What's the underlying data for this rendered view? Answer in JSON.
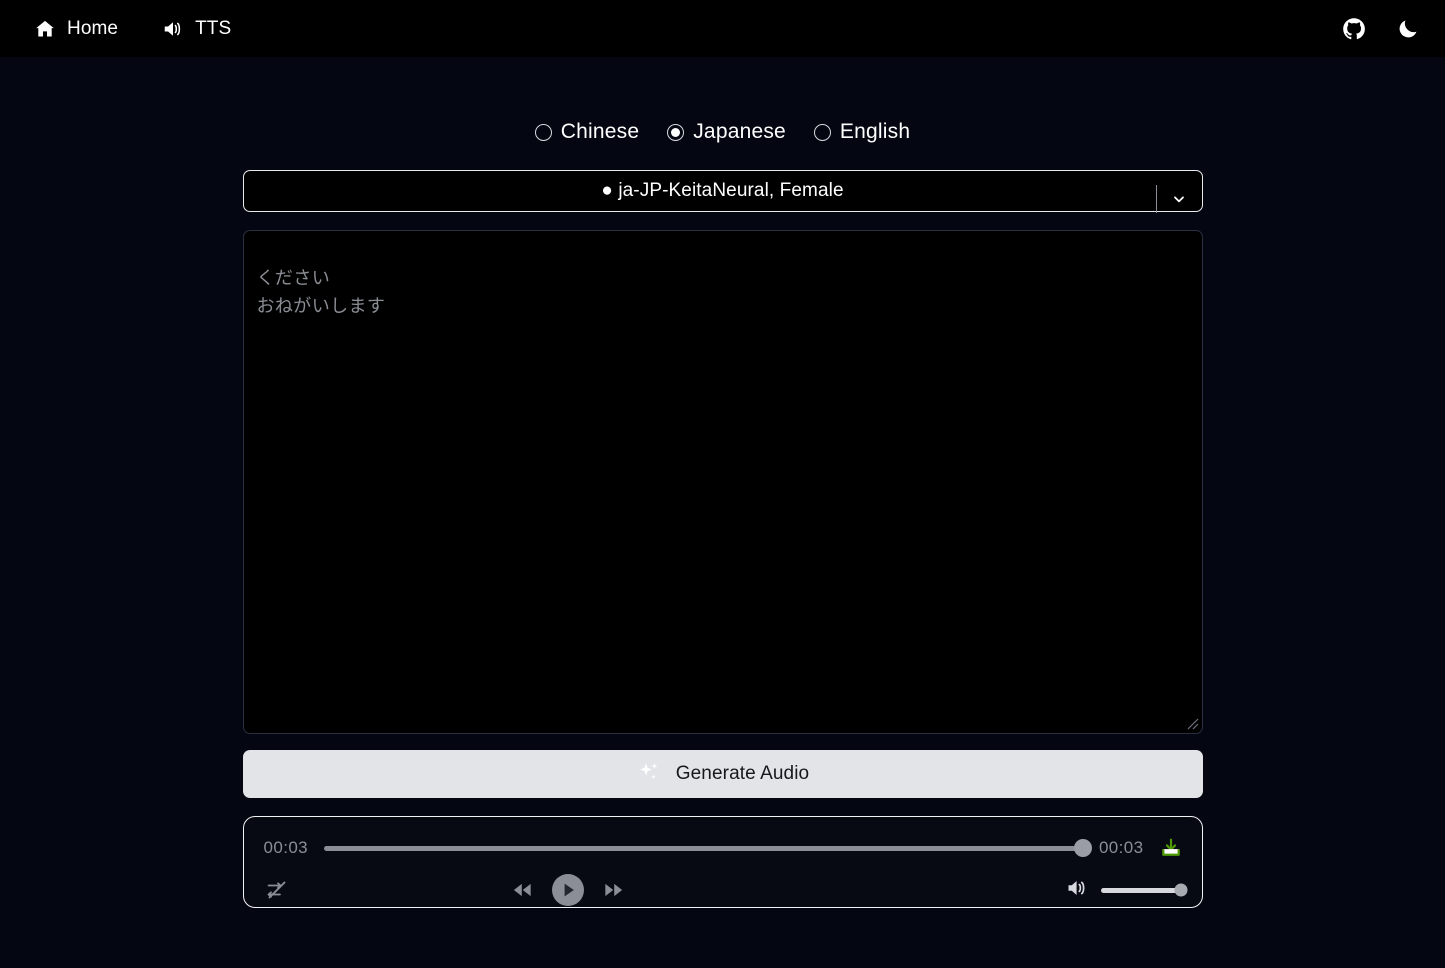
{
  "header": {
    "nav_items": [
      {
        "label": "Home",
        "icon": "home-icon"
      },
      {
        "label": "TTS",
        "icon": "speaker-icon"
      }
    ],
    "github_icon": "github-icon",
    "theme_toggle_icon": "moon-icon"
  },
  "language": {
    "options": [
      {
        "label": "Chinese",
        "selected": false
      },
      {
        "label": "Japanese",
        "selected": true
      },
      {
        "label": "English",
        "selected": false
      }
    ]
  },
  "voice_select": {
    "value": "● ja-JP-KeitaNeural, Female",
    "arrow_icon": "chevron-down-icon"
  },
  "input": {
    "text": "ください\nおねがいします",
    "placeholder": "ください\nおねがいします"
  },
  "generate": {
    "label": "Generate Audio",
    "icon": "sparkles-icon"
  },
  "player": {
    "current_time": "00:03",
    "total_time": "00:03",
    "progress_percent": 100,
    "volume_percent": 100,
    "download_icon": "download-icon",
    "download_color": "#4e9a06",
    "shuffle_icon": "shuffle-off-icon",
    "rewind_icon": "rewind-icon",
    "play_icon": "play-icon",
    "forward_icon": "fast-forward-icon",
    "volume_icon": "volume-icon"
  },
  "colors": {
    "header_bg": "#000000",
    "page_bg": "#040711",
    "accent_button": "#e3e4e8",
    "muted_text": "#8b8e96"
  }
}
